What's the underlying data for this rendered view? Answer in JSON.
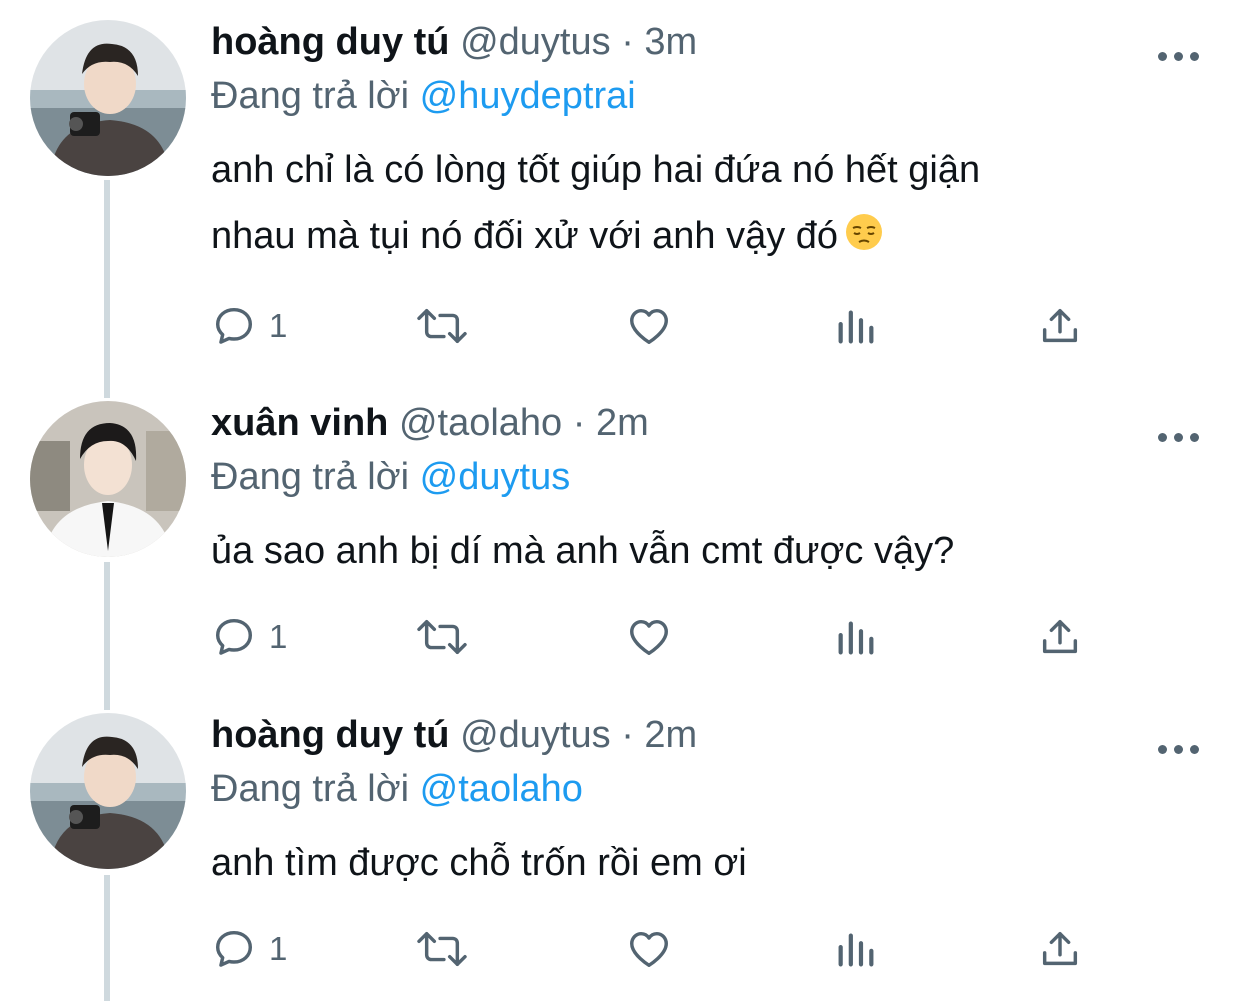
{
  "tweets": [
    {
      "name": "hoàng duy tú",
      "handle": "@duytus",
      "separator": "·",
      "time": "3m",
      "reply_prefix": "Đang trả lời",
      "reply_to": "@huydeptrai",
      "lines": [
        "anh chỉ là có lòng tốt giúp hai đứa nó hết giận",
        "nhau mà tụi nó đối xử với anh vậy đó"
      ],
      "emoji": "pensive-face",
      "reply_count": "1"
    },
    {
      "name": "xuân vinh",
      "handle": "@taolaho",
      "separator": "·",
      "time": "2m",
      "reply_prefix": "Đang trả lời",
      "reply_to": "@duytus",
      "lines": [
        "ủa sao anh bị dí mà anh vẫn cmt được vậy?"
      ],
      "reply_count": "1"
    },
    {
      "name": "hoàng duy tú",
      "handle": "@duytus",
      "separator": "·",
      "time": "2m",
      "reply_prefix": "Đang trả lời",
      "reply_to": "@taolaho",
      "lines": [
        "anh tìm được chỗ trốn rồi em ơi"
      ],
      "reply_count": "1"
    }
  ],
  "icons": {
    "reply": "reply-bubble-icon",
    "retweet": "retweet-icon",
    "like": "heart-icon",
    "views": "analytics-bars-icon",
    "share": "share-upload-icon",
    "more": "more-dots-icon"
  },
  "colors": {
    "text": "#0f1419",
    "secondary": "#536471",
    "link": "#1d9bf0",
    "thread_line": "#cfd9de"
  }
}
